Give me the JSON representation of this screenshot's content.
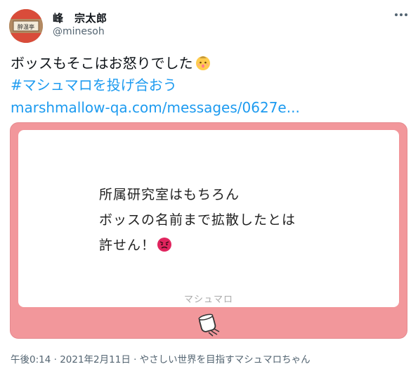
{
  "user": {
    "display_name": "峰　宗太郎",
    "handle": "@minesoh",
    "avatar_text": "醉温亭"
  },
  "tweet": {
    "text": "ボッスもそこはお怒りでした",
    "hashtag": "#マシュマロを投げ合おう",
    "link": "marshmallow-qa.com/messages/0627e..."
  },
  "card": {
    "message_lines": [
      "所属研究室はもちろん",
      "ボッスの名前まで拡散したとは",
      "許せん！"
    ],
    "brand": "マシュマロ",
    "colors": {
      "frame": "#f2979b",
      "angry": "#e0245e"
    }
  },
  "meta": {
    "text": "午後0:14 · 2021年2月11日 · やさしい世界を目指すマシュマロちゃん"
  },
  "icons": [
    "more-icon",
    "baby-emoji-icon",
    "angry-emoji-icon",
    "marshmallow-icon"
  ]
}
